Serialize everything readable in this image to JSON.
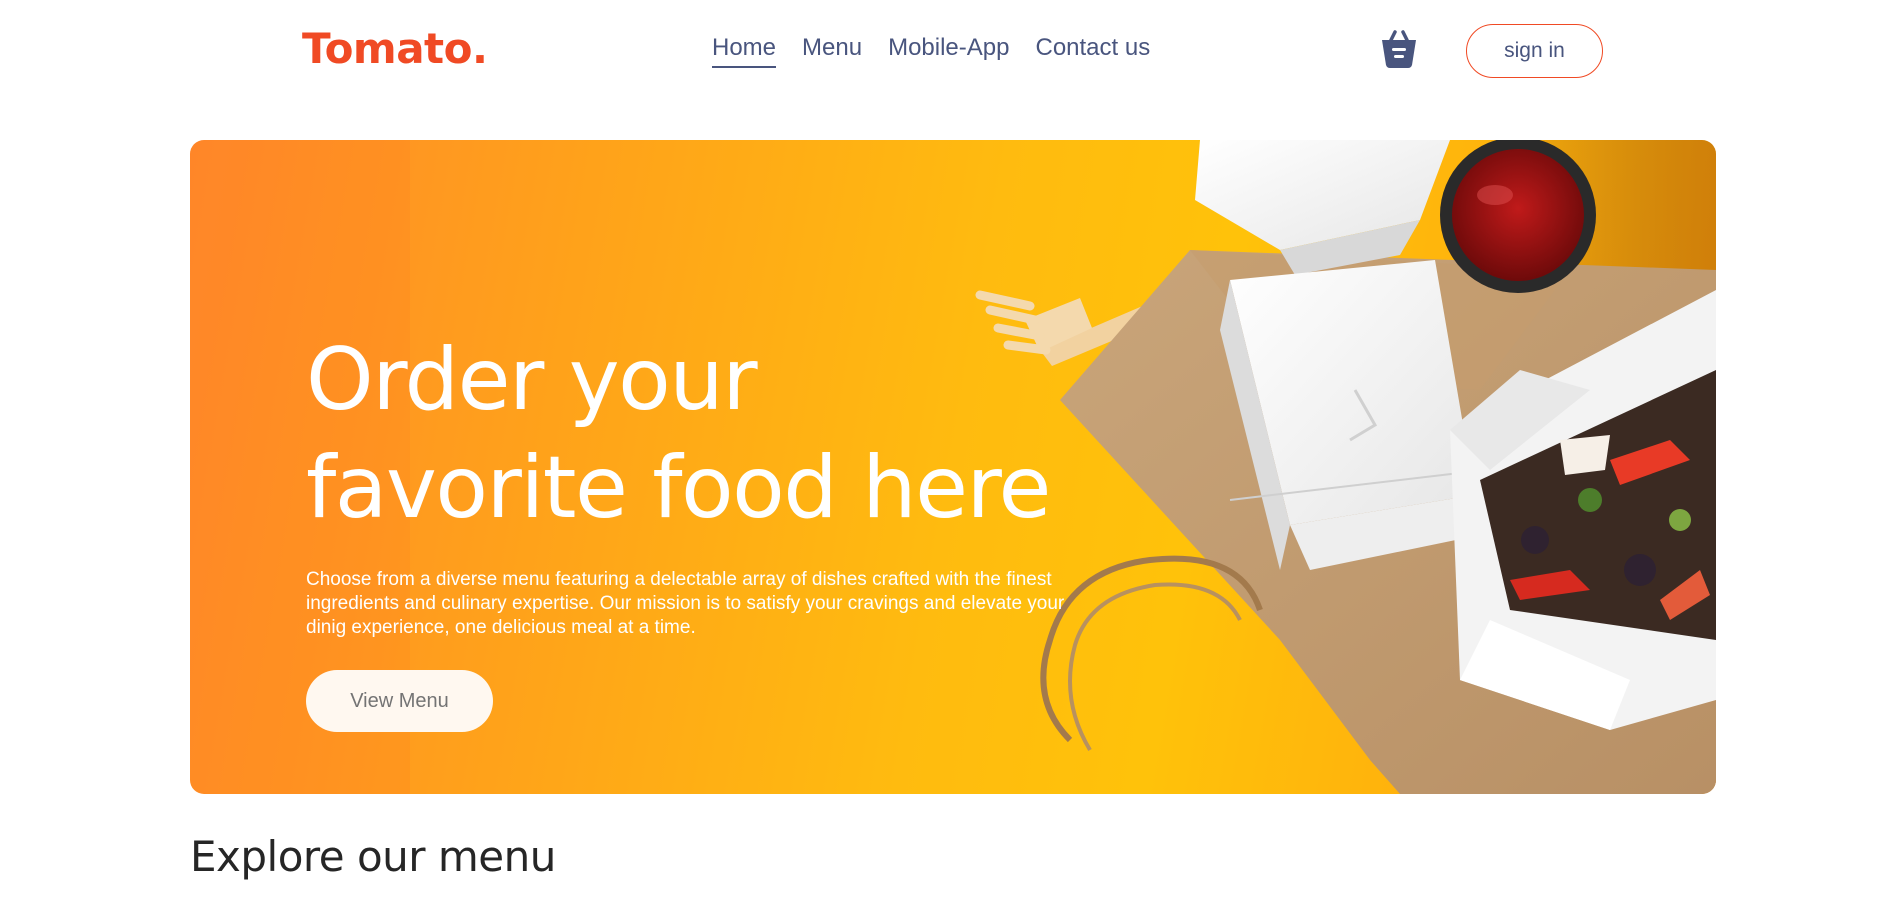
{
  "brand": {
    "logo_text": "Tomato.",
    "accent_color": "#f04a24",
    "text_color": "#49557e"
  },
  "navbar": {
    "items": [
      {
        "label": "Home",
        "active": true
      },
      {
        "label": "Menu",
        "active": false
      },
      {
        "label": "Mobile-App",
        "active": false
      },
      {
        "label": "Contact us",
        "active": false
      }
    ],
    "basket_icon": "basket-icon",
    "signin_label": "sign in"
  },
  "hero": {
    "title_line1": "Order your",
    "title_line2": "favorite food here",
    "description": "Choose from a diverse menu featuring a delectable array of dishes crafted with the finest ingredients and culinary expertise. Our mission is to satisfy your cravings and elevate your dinig experience, one delicious meal at a time.",
    "cta_label": "View Menu",
    "image": "takeaway-food-boxes-photo"
  },
  "explore": {
    "title": "Explore our menu"
  }
}
